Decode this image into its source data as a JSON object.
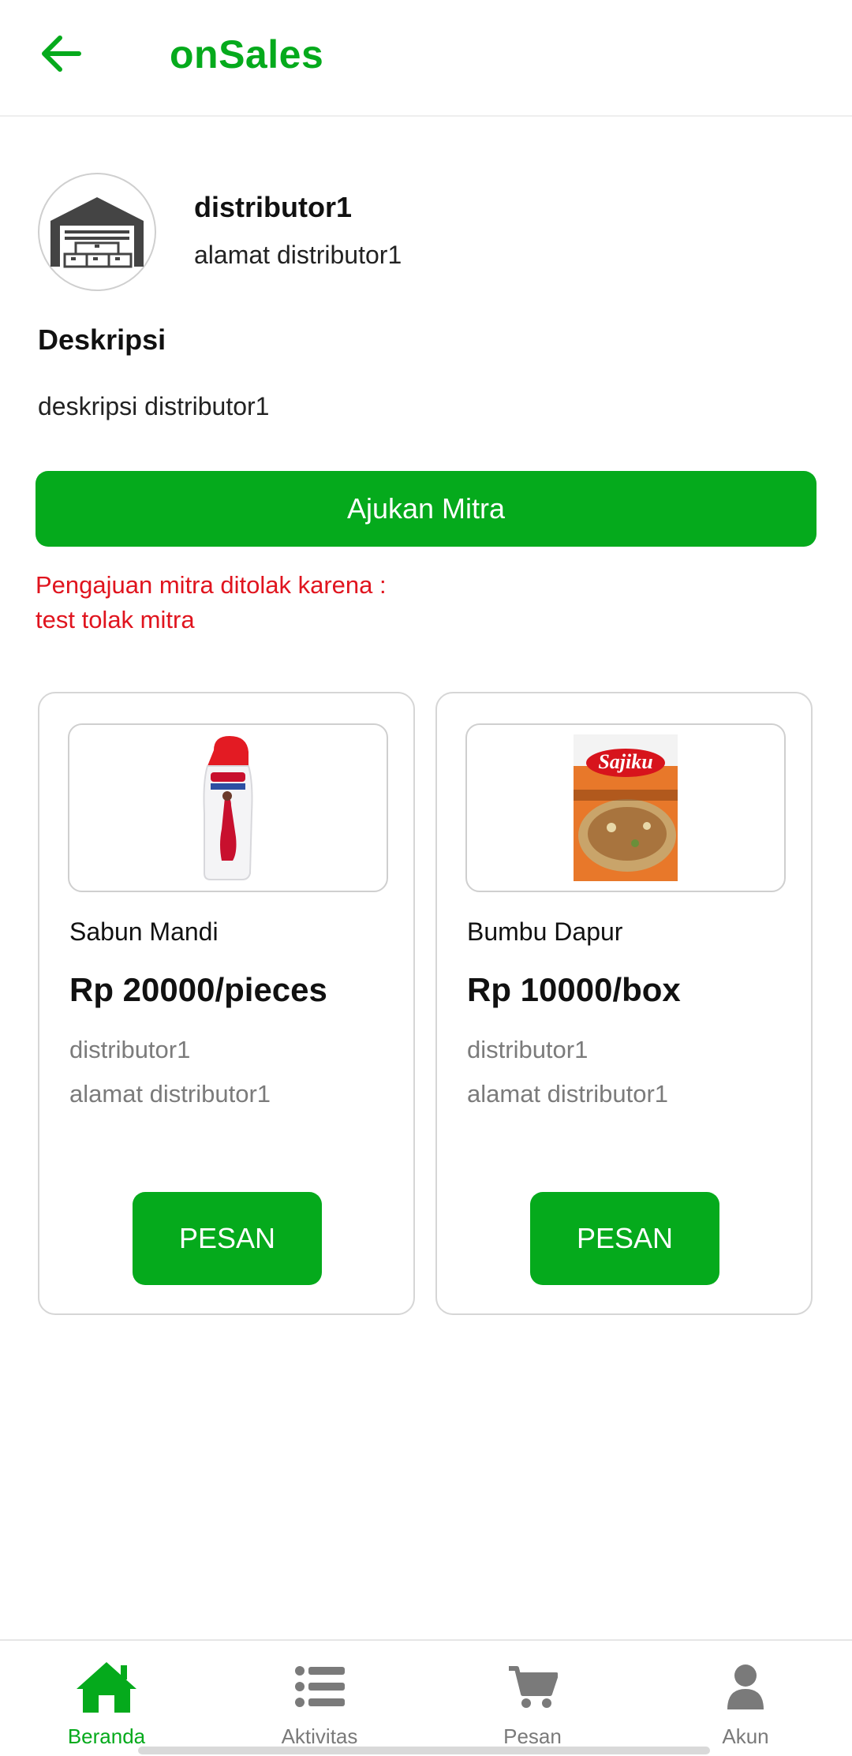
{
  "header": {
    "title": "onSales",
    "back_icon": "arrow-left-icon"
  },
  "colors": {
    "brand": "#05aa1c",
    "error": "#e0141e",
    "muted": "#7b7b7b"
  },
  "distributor": {
    "name": "distributor1",
    "address": "alamat distributor1",
    "avatar_icon": "warehouse-icon",
    "description_heading": "Deskripsi",
    "description": "deskripsi distributor1"
  },
  "partnership": {
    "apply_label": "Ajukan Mitra",
    "reject_line1": "Pengajuan mitra ditolak karena :",
    "reject_line2": "test tolak mitra"
  },
  "products": [
    {
      "name": "Sabun Mandi",
      "price": "Rp 20000/pieces",
      "distributor": "distributor1",
      "address": "alamat distributor1",
      "button_label": "PESAN",
      "image_icon": "soap-bottle-icon"
    },
    {
      "name": "Bumbu Dapur",
      "price": "Rp 10000/box",
      "distributor": "distributor1",
      "address": "alamat distributor1",
      "button_label": "PESAN",
      "image_icon": "seasoning-pack-icon",
      "image_text": "Sajiku"
    }
  ],
  "bottom_nav": [
    {
      "label": "Beranda",
      "icon": "home-icon",
      "active": true
    },
    {
      "label": "Aktivitas",
      "icon": "list-icon",
      "active": false
    },
    {
      "label": "Pesan",
      "icon": "cart-icon",
      "active": false
    },
    {
      "label": "Akun",
      "icon": "user-icon",
      "active": false
    }
  ]
}
